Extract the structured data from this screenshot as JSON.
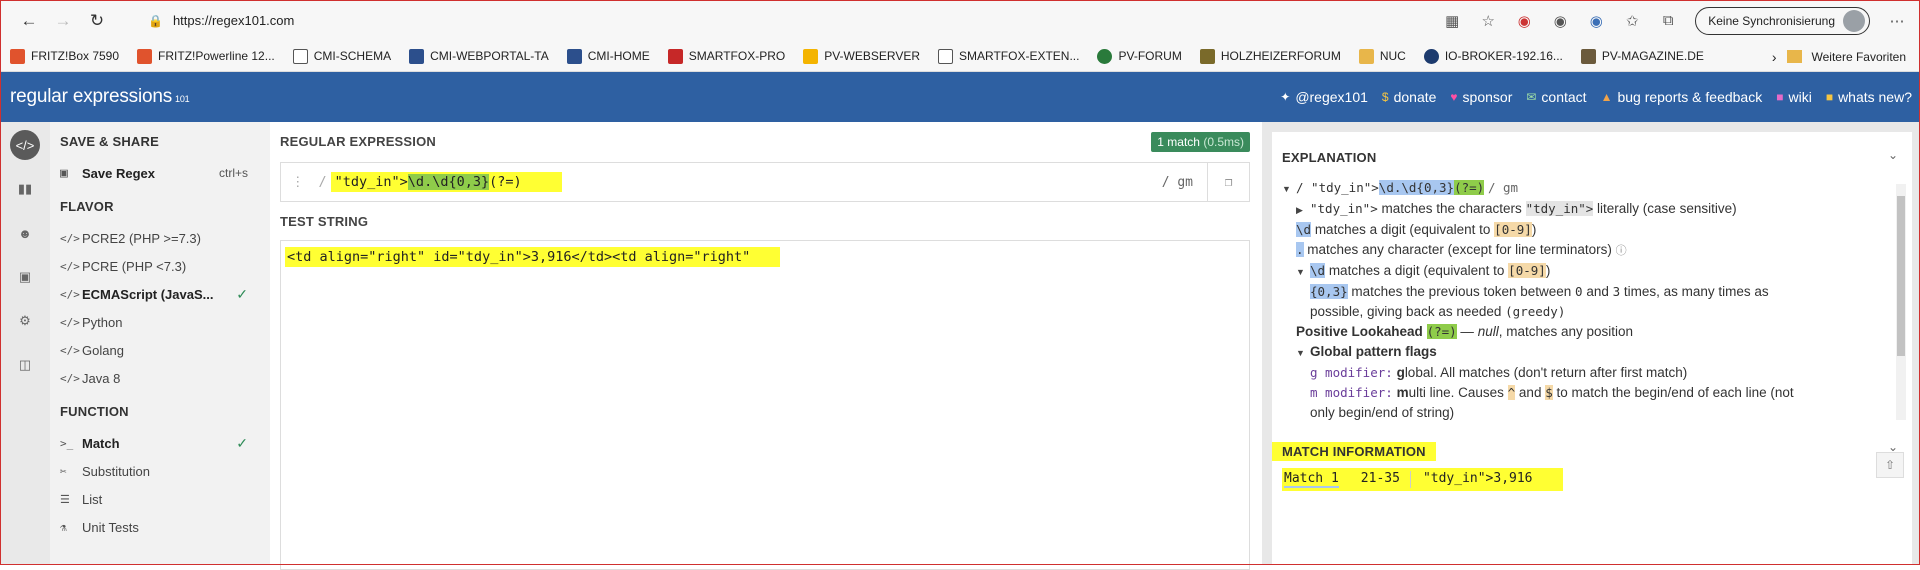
{
  "browser": {
    "url": "https://regex101.com",
    "sync_label": "Keine Synchronisierung",
    "bookmarks": [
      "FRITZ!Box 7590",
      "FRITZ!Powerline 12...",
      "CMI-SCHEMA",
      "CMI-WEBPORTAL-TA",
      "CMI-HOME",
      "SMARTFOX-PRO",
      "PV-WEBSERVER",
      "SMARTFOX-EXTEN...",
      "PV-FORUM",
      "HOLZHEIZERFORUM",
      "NUC",
      "IO-BROKER-192.16...",
      "PV-MAGAZINE.DE"
    ],
    "other_favorites": "Weitere Favoriten"
  },
  "site": {
    "logo": "regular expressions",
    "logo_sub": "101",
    "nav": {
      "twitter": "@regex101",
      "donate": "donate",
      "sponsor": "sponsor",
      "contact": "contact",
      "bugs": "bug reports & feedback",
      "wiki": "wiki",
      "whats_new": "whats new?"
    }
  },
  "sidebar": {
    "save_share_title": "SAVE & SHARE",
    "save_regex": "Save Regex",
    "save_shortcut": "ctrl+s",
    "flavor_title": "FLAVOR",
    "flavors": [
      "PCRE2 (PHP >=7.3)",
      "PCRE (PHP <7.3)",
      "ECMAScript (JavaS...",
      "Python",
      "Golang",
      "Java 8"
    ],
    "function_title": "FUNCTION",
    "functions": [
      "Match",
      "Substitution",
      "List",
      "Unit Tests"
    ]
  },
  "main": {
    "regex_title": "REGULAR EXPRESSION",
    "match_badge": "1 match",
    "match_time": "(0.5ms)",
    "regex_delim_open": "/",
    "regex_literal": "\"tdy_in\">",
    "regex_tok1": "\\d",
    "regex_tok2": ".",
    "regex_tok3": "\\d",
    "regex_tok4": "{0,3}",
    "regex_tok5": "(?=)",
    "regex_flags": "/ gm",
    "test_title": "TEST STRING",
    "test_string": "<td align=\"right\" id=\"tdy_in\">3,916</td><td align=\"right\""
  },
  "explanation": {
    "title": "EXPLANATION",
    "header_literal": "/ \"tdy_in\">",
    "header_tok": "\\d.\\d{0,3}",
    "header_look": "(?=)",
    "header_flags": "/ gm",
    "l1_tok": "\"tdy_in\">",
    "l1_text": " matches the characters ",
    "l1_tok2": "\"tdy_in\">",
    "l1_text2": " literally (case sensitive)",
    "l2_tok": "\\d",
    "l2_text": " matches a digit (equivalent to ",
    "l2_range": "[0-9]",
    "l2_close": ")",
    "l3_tok": ".",
    "l3_text": " matches any character (except for line terminators)",
    "l4_tok": "\\d",
    "l4_text": " matches a digit (equivalent to ",
    "l4_range": "[0-9]",
    "l4_close": ")",
    "l5_tok": "{0,3}",
    "l5_text": " matches the previous token between ",
    "l5_a": "0",
    "l5_and": " and ",
    "l5_b": "3",
    "l5_text2": " times, as many times as",
    "l6_text": "possible, giving back as needed ",
    "l6_greedy": "(greedy)",
    "l7_bold": "Positive Lookahead",
    "l7_tok": "(?=)",
    "l7_dash": " — ",
    "l7_null": "null",
    "l7_text": ", matches any position",
    "l8_bold": "Global pattern flags",
    "l9_mod": "g modifier:",
    "l9_b": "g",
    "l9_text": "lobal. All matches (don't return after first match)",
    "l10_mod": "m modifier:",
    "l10_b": "m",
    "l10_text": "ulti line. Causes ",
    "l10_c1": "^",
    "l10_and": " and ",
    "l10_c2": "$",
    "l10_text2": " to match the begin/end of each line (not",
    "l11_text": "only begin/end of string)"
  },
  "match_info": {
    "title": "MATCH INFORMATION",
    "match_label": "Match 1",
    "range": "21-35",
    "value": "\"tdy_in\">3,916"
  },
  "colors": {
    "header_bg": "#2e60a2",
    "highlight": "#ffff33",
    "match_badge": "#3a8b5c"
  }
}
